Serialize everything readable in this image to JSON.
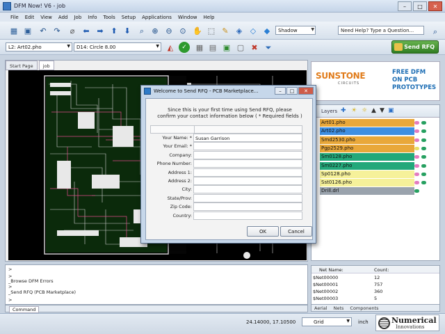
{
  "window": {
    "title": "DFM Now! V6 - job"
  },
  "menu": [
    "File",
    "Edit",
    "View",
    "Add",
    "Job",
    "Info",
    "Tools",
    "Setup",
    "Applications",
    "Window",
    "Help"
  ],
  "toolbar": {
    "render_mode": "Shadow",
    "help_placeholder": "Need Help? Type a Question..."
  },
  "toolbar2": {
    "layer_combo": "L2: Art02.pho",
    "dcode_combo": "D14: Circle 8.00",
    "send_rfq": "Send RFQ"
  },
  "doc_tabs": [
    "Start Page",
    "job"
  ],
  "ad": {
    "brand": "SUNSTONE",
    "brand_sub": "CIRCUITS",
    "tagline": [
      "FREE DFM",
      "ON PCB",
      "PROTOTYPES"
    ]
  },
  "layers_panel": {
    "label": "Layers",
    "items": [
      {
        "name": "Art01.pho",
        "color": "#e9a83a",
        "dot1": "#e37cc0",
        "dot2": "#26a060"
      },
      {
        "name": "Art02.pho",
        "color": "#3e8fe2",
        "dot1": "#e37cc0",
        "dot2": "#26a060"
      },
      {
        "name": "Smd2530.pho",
        "color": "#e9a83a",
        "dot1": "#e37cc0",
        "dot2": "#26a060"
      },
      {
        "name": "Pgp2529.pho",
        "color": "#e9a83a",
        "dot1": "#e8e06a",
        "dot2": "#26a060"
      },
      {
        "name": "Sm0128.pho",
        "color": "#23a87a",
        "dot1": "#e37cc0",
        "dot2": "#26a060"
      },
      {
        "name": "Sm0227.pho",
        "color": "#23a87a",
        "dot1": "#e37cc0",
        "dot2": "#26a060"
      },
      {
        "name": "Sp0128.pho",
        "color": "#f6f19a",
        "dot1": "#e37cc0",
        "dot2": "#26a060"
      },
      {
        "name": "Sst0126.pho",
        "color": "#f6f19a",
        "dot1": "#e37cc0",
        "dot2": "#26a060"
      },
      {
        "name": "Drill.drl",
        "color": "#9aa3ad",
        "dot1": "#26a060",
        "dot2": ""
      }
    ]
  },
  "nets": {
    "col_name": "Net Name:",
    "col_count": "Count:",
    "rows": [
      {
        "name": "$Net00000",
        "count": "12"
      },
      {
        "name": "$Net00001",
        "count": "757"
      },
      {
        "name": "$Net00002",
        "count": "360"
      },
      {
        "name": "$Net00003",
        "count": "5"
      }
    ],
    "tabs": [
      "Aerial",
      "Nets",
      "Components"
    ]
  },
  "output": {
    "lines": [
      ">",
      "> ",
      "_Browse DFM Errors",
      ">",
      "_Send RFQ (PCB Marketplace)",
      ">"
    ],
    "tab": "Command"
  },
  "status": {
    "coords": "24.14000, 17.10500",
    "grid": "Grid",
    "unit": "inch"
  },
  "brand_logo": {
    "line1": "Numerical",
    "line2": "Innovations"
  },
  "dialog": {
    "title": "Welcome to Send RFQ - PCB Marketplace...",
    "intro1": "Since this is your first time using Send RFQ, please",
    "intro2": "confirm your contact information below  ( * Required fields )",
    "fields": [
      {
        "label": "Your Name: *",
        "value": "Susan Garrison"
      },
      {
        "label": "Your Email: *",
        "value": ""
      },
      {
        "label": "Company:",
        "value": ""
      },
      {
        "label": "Phone Number:",
        "value": ""
      },
      {
        "label": "Address 1:",
        "value": ""
      },
      {
        "label": "Address 2:",
        "value": ""
      },
      {
        "label": "City:",
        "value": ""
      },
      {
        "label": "State/Prov:",
        "value": ""
      },
      {
        "label": "Zip Code:",
        "value": ""
      },
      {
        "label": "Country:",
        "value": ""
      }
    ],
    "ok": "OK",
    "cancel": "Cancel"
  }
}
